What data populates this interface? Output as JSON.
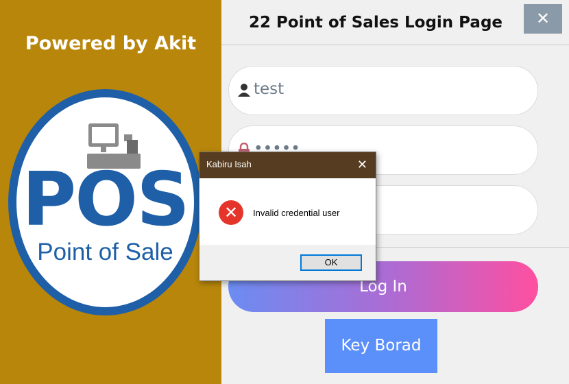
{
  "left_panel": {
    "powered_by": "Powered by Akit",
    "logo": {
      "big_text": "POS",
      "sub_text": "Point of Sale",
      "icon": "pos-terminal-icon"
    }
  },
  "window": {
    "title": "22 Point of Sales Login Page",
    "close_glyph": "✕"
  },
  "form": {
    "username": {
      "value": "test",
      "icon": "user-icon"
    },
    "password": {
      "value": "•••••",
      "icon": "lock-icon"
    },
    "login_label": "Log In",
    "keyboard_label": "Key Borad"
  },
  "dialog": {
    "title": "Kabiru Isah",
    "close_glyph": "✕",
    "icon": "error-icon",
    "message": "Invalid credential user",
    "ok_label": "OK"
  },
  "colors": {
    "left_bg": "#b8860b",
    "logo_blue": "#1e5fa8",
    "dialog_title_bg": "#563d22",
    "keyboard_btn": "#5b8ff9"
  }
}
